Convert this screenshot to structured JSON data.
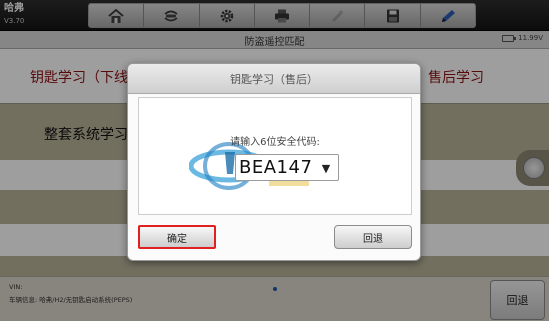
{
  "app": {
    "brand": "哈弗",
    "version": "V3.70"
  },
  "toolbar": {
    "tools": [
      {
        "icon": "home-icon"
      },
      {
        "icon": "vehicle-swap-icon"
      },
      {
        "icon": "gear-icon"
      },
      {
        "icon": "printer-icon"
      },
      {
        "icon": "help-icon",
        "disabled": true
      },
      {
        "icon": "save-icon"
      },
      {
        "icon": "pen-icon"
      }
    ]
  },
  "header": {
    "title": "防盗遥控匹配",
    "battery": "11.99V"
  },
  "menu": {
    "item_key_learn_offline": "钥匙学习（下线",
    "item_after_sales": "售后学习",
    "item_full_system": "整套系统学习"
  },
  "footer": {
    "vin_label": "VIN:",
    "vehicle_info": "车辆信息: 哈弗/H2/无钥匙启动系统(PEPS)",
    "back_label": "回退"
  },
  "dialog": {
    "title": "钥匙学习（售后）",
    "prompt": "请输入6位安全代码:",
    "code_value": "BEA147",
    "ok_label": "确定",
    "back_label": "回退"
  },
  "colors": {
    "menu_accent": "#8e1212",
    "highlight_border": "#e02020",
    "pager_dot": "#2255aa"
  }
}
